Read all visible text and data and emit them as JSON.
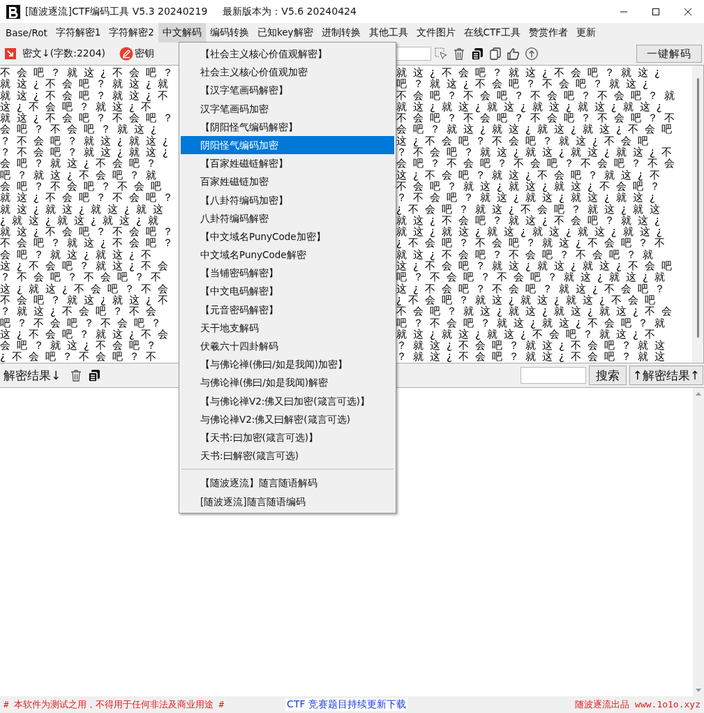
{
  "window": {
    "title": "[随波逐流]CTF编码工具 V5.3 20240219",
    "latest_version": "最新版本为：V5.6 20240424"
  },
  "menu_bar": [
    {
      "label": "Base/Rot",
      "selected": false
    },
    {
      "label": "字符解密1",
      "selected": false
    },
    {
      "label": "字符解密2",
      "selected": false
    },
    {
      "label": "中文解码",
      "selected": true
    },
    {
      "label": "编码转换",
      "selected": false
    },
    {
      "label": "已知key解密",
      "selected": false
    },
    {
      "label": "进制转换",
      "selected": false
    },
    {
      "label": "其他工具",
      "selected": false
    },
    {
      "label": "文件图片",
      "selected": false
    },
    {
      "label": "在线CTF工具",
      "selected": false
    },
    {
      "label": "赞赏作者",
      "selected": false
    },
    {
      "label": "更新",
      "selected": false
    }
  ],
  "cipher_toolbar": {
    "label": "密文↓(字数:2204)",
    "key_label": "密钥",
    "decode_all_button": "一键解码"
  },
  "cipher_text": {
    "lines": [
      {
        "left": "不会吧？就这¿不会吧？",
        "right": "就这¿不会吧？就这¿不会吧？就这¿"
      },
      {
        "left": "就这¿不会吧？就这¿就",
        "right": "吧？就这¿不会吧？不会吧？就这¿"
      },
      {
        "left": "就这¿不会吧？就这¿不",
        "right": "不会吧？不会吧？不会吧？不会吧？就"
      },
      {
        "left": "这¿不会吧？就这¿不",
        "right": "就这¿就这¿就这¿就这¿就这¿就这¿"
      },
      {
        "left": "就这¿不会吧？不会吧？",
        "right": "不会吧？不会吧？不会吧？不会吧？不"
      },
      {
        "left": "会吧？不会吧？就这¿",
        "right": "会吧？就这¿就这¿就这¿就这¿不会吧"
      },
      {
        "left": "？不会吧？就这¿就这¿",
        "right": "这¿不会吧？不会吧？就这¿不会吧"
      },
      {
        "left": "？不会吧？就这¿就这¿",
        "right": "？不会吧？就这¿就这¿就这¿就这¿不"
      },
      {
        "left": "会吧？就这¿不会吧？",
        "right": "会吧？不会吧？不会吧？不会吧？不会"
      },
      {
        "left": "吧？就这¿不会吧？就",
        "right": "这¿不会吧？就这¿不会吧？就这¿不"
      },
      {
        "left": "会吧？不会吧？不会吧",
        "right": "不会吧？就这¿就这¿就这¿不会吧？"
      },
      {
        "left": "就这¿不会吧？不会吧？",
        "right": "？不会吧？就这¿就这¿就这¿就这¿"
      },
      {
        "left": "就这¿就这¿就这¿就这",
        "right": "¿不会吧？就这¿不会吧？就这¿就这"
      },
      {
        "left": "¿就这¿就这¿就这¿就",
        "right": "就这¿不会吧？就这¿不会吧？就这¿"
      },
      {
        "left": "就这¿不会吧？不会吧？",
        "right": "就这¿就这¿就这¿就这¿就这¿就这¿"
      },
      {
        "left": "不会吧？就这¿不会吧？",
        "right": "¿不会吧？不会吧？就这¿不会吧？不"
      },
      {
        "left": "会吧？就这¿就这¿不",
        "right": "就这¿不会吧？不会吧？不会吧？就"
      },
      {
        "left": "这¿不会吧？就这¿不会",
        "right": "这¿不会吧？就这¿就这¿就这¿不会吧"
      },
      {
        "left": "？不会吧？不会吧？不",
        "right": "吧？不会吧？不会吧？就这¿就这¿就"
      },
      {
        "left": "这¿就这¿不会吧？不会",
        "right": "这¿不会吧？不会吧？就这¿不会吧？"
      },
      {
        "left": "不会吧？就这¿就这¿不",
        "right": "¿不会吧？就这¿就这¿就这¿不会吧"
      },
      {
        "left": "？就这¿不会吧？不会",
        "right": "不会吧？就这¿就这¿就这¿就这¿不会"
      },
      {
        "left": "吧？不会吧？不会吧？",
        "right": "吧？不会吧？就这¿就这¿不会吧？就"
      },
      {
        "left": "这¿不会吧？就这¿不会",
        "right": "就这¿就这¿就这¿不会吧？就这¿不"
      },
      {
        "left": "会吧？就这¿不会吧？",
        "right": "？就这¿不会吧？就这¿不会吧？就这"
      },
      {
        "left": "¿不会吧？不会吧？不",
        "right": "？就这¿不会吧？就这¿不会吧？就这"
      }
    ]
  },
  "dropdown_menu": {
    "items": [
      {
        "label": "【社会主义核心价值观解密】",
        "selected": false,
        "separator_before": false
      },
      {
        "label": "社会主义核心价值观加密",
        "selected": false,
        "separator_before": false
      },
      {
        "label": "【汉字笔画码解密】",
        "selected": false,
        "separator_before": false
      },
      {
        "label": "汉字笔画码加密",
        "selected": false,
        "separator_before": false
      },
      {
        "label": "【阴阳怪气编码解密】",
        "selected": false,
        "separator_before": false
      },
      {
        "label": "阴阳怪气编码加密",
        "selected": true,
        "separator_before": false
      },
      {
        "label": "【百家姓磁链解密】",
        "selected": false,
        "separator_before": false
      },
      {
        "label": "百家姓磁链加密",
        "selected": false,
        "separator_before": false
      },
      {
        "label": "【八卦符编码加密】",
        "selected": false,
        "separator_before": false
      },
      {
        "label": "八卦符编码解密",
        "selected": false,
        "separator_before": false
      },
      {
        "label": "【中文域名PunyCode加密】",
        "selected": false,
        "separator_before": false
      },
      {
        "label": "中文域名PunyCode解密",
        "selected": false,
        "separator_before": false
      },
      {
        "label": "【当铺密码解密】",
        "selected": false,
        "separator_before": false
      },
      {
        "label": "【中文电码解密】",
        "selected": false,
        "separator_before": false
      },
      {
        "label": "【元音密码解密】",
        "selected": false,
        "separator_before": false
      },
      {
        "label": "天干地支解码",
        "selected": false,
        "separator_before": false
      },
      {
        "label": "伏羲六十四卦解码",
        "selected": false,
        "separator_before": false
      },
      {
        "label": "【与佛论禅(佛曰/如是我闻)加密】",
        "selected": false,
        "separator_before": false
      },
      {
        "label": "与佛论禅(佛曰/如是我闻)解密",
        "selected": false,
        "separator_before": false
      },
      {
        "label": "【与佛论禅V2:佛又曰加密(箴言可选)】",
        "selected": false,
        "separator_before": false
      },
      {
        "label": "与佛论禅V2:佛又曰解密(箴言可选)",
        "selected": false,
        "separator_before": false
      },
      {
        "label": "【天书:曰加密(箴言可选)】",
        "selected": false,
        "separator_before": false
      },
      {
        "label": "天书:曰解密(箴言可选)",
        "selected": false,
        "separator_before": false
      },
      {
        "label": "【随波逐流】随言随语解码",
        "selected": false,
        "separator_before": true
      },
      {
        "label": "[随波逐流]随言随语编码",
        "selected": false,
        "separator_before": false
      }
    ]
  },
  "result_bar": {
    "label": "解密结果↓",
    "search_button": "搜索",
    "result_up_button": "↑解密结果↑"
  },
  "footer": {
    "notice": "# 本软件为测试之用，不得用于任何非法及商业用途 #",
    "download_link": "CTF 竞赛题目持续更新下载",
    "credit": "随波逐流出品 www.1o1o.xyz"
  }
}
